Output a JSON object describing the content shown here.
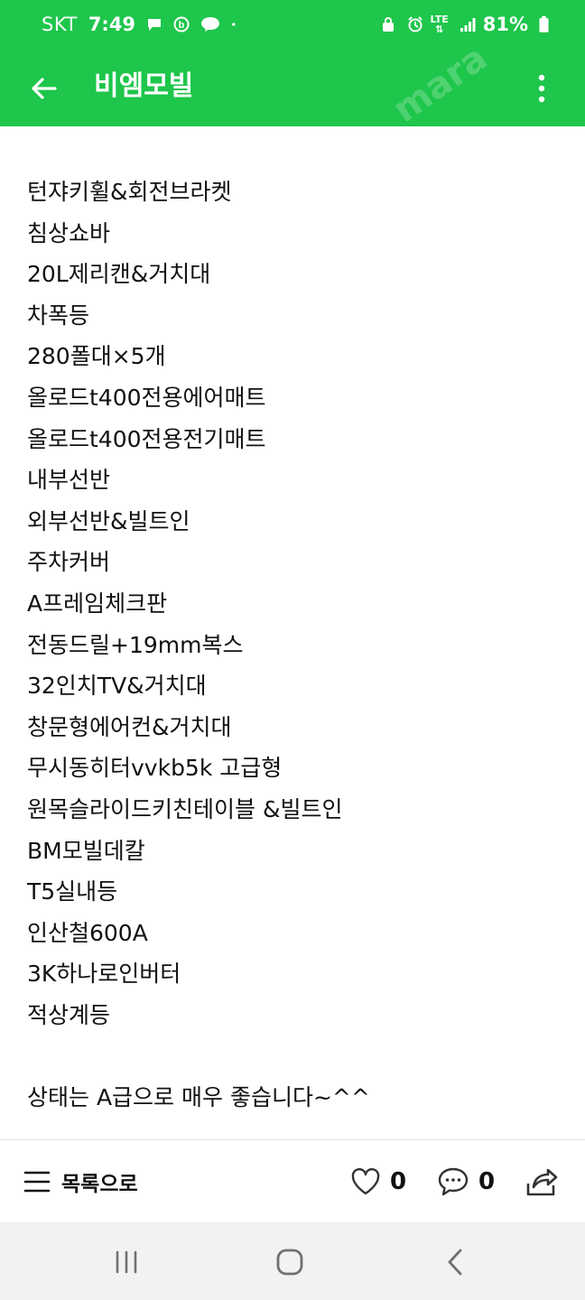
{
  "status_bar": {
    "carrier": "SKT",
    "time": "7:49",
    "battery": "81%",
    "left_icons": [
      "chat-bubble-icon",
      "b-app-icon",
      "talk-icon",
      "dot-icon"
    ],
    "right_icons": [
      "alarm-lock-icon",
      "clock-icon",
      "lte-icon",
      "signal-icon",
      "battery-icon"
    ],
    "lte_label": "LTE"
  },
  "app_bar": {
    "title": "비엠모빌",
    "back_icon": "arrow-left-icon",
    "more_icon": "more-vertical-icon"
  },
  "post": {
    "items": [
      "턴쟈키휠&회전브라켓",
      "침상쇼바",
      "20L제리캔&거치대",
      "차폭등",
      "280폴대×5개",
      "올로드t400전용에어매트",
      "올로드t400전용전기매트",
      "내부선반",
      "외부선반&빌트인",
      "주차커버",
      "A프레임체크판",
      "전동드릴+19mm복스",
      "32인치TV&거치대",
      "창문형에어컨&거치대",
      "무시동히터vvkb5k 고급형",
      "원목슬라이드키친테이블 &빌트인",
      "BM모빌데칼",
      "T5실내등",
      "인산철600A",
      "3K하나로인버터",
      "적상계등"
    ],
    "closing": "상태는 A급으로 매우 좋습니다~^^"
  },
  "action_bar": {
    "list_label": "목록으로",
    "like_count": "0",
    "comment_count": "0",
    "icons": [
      "menu-lines-icon",
      "heart-icon",
      "comment-icon",
      "share-icon"
    ]
  },
  "nav_bar": {
    "icons": [
      "recent-apps-icon",
      "home-icon",
      "back-chevron-icon"
    ]
  },
  "colors": {
    "primary_green": "#1ec64b",
    "nav_background": "#f2f2f2",
    "text": "#111111"
  }
}
